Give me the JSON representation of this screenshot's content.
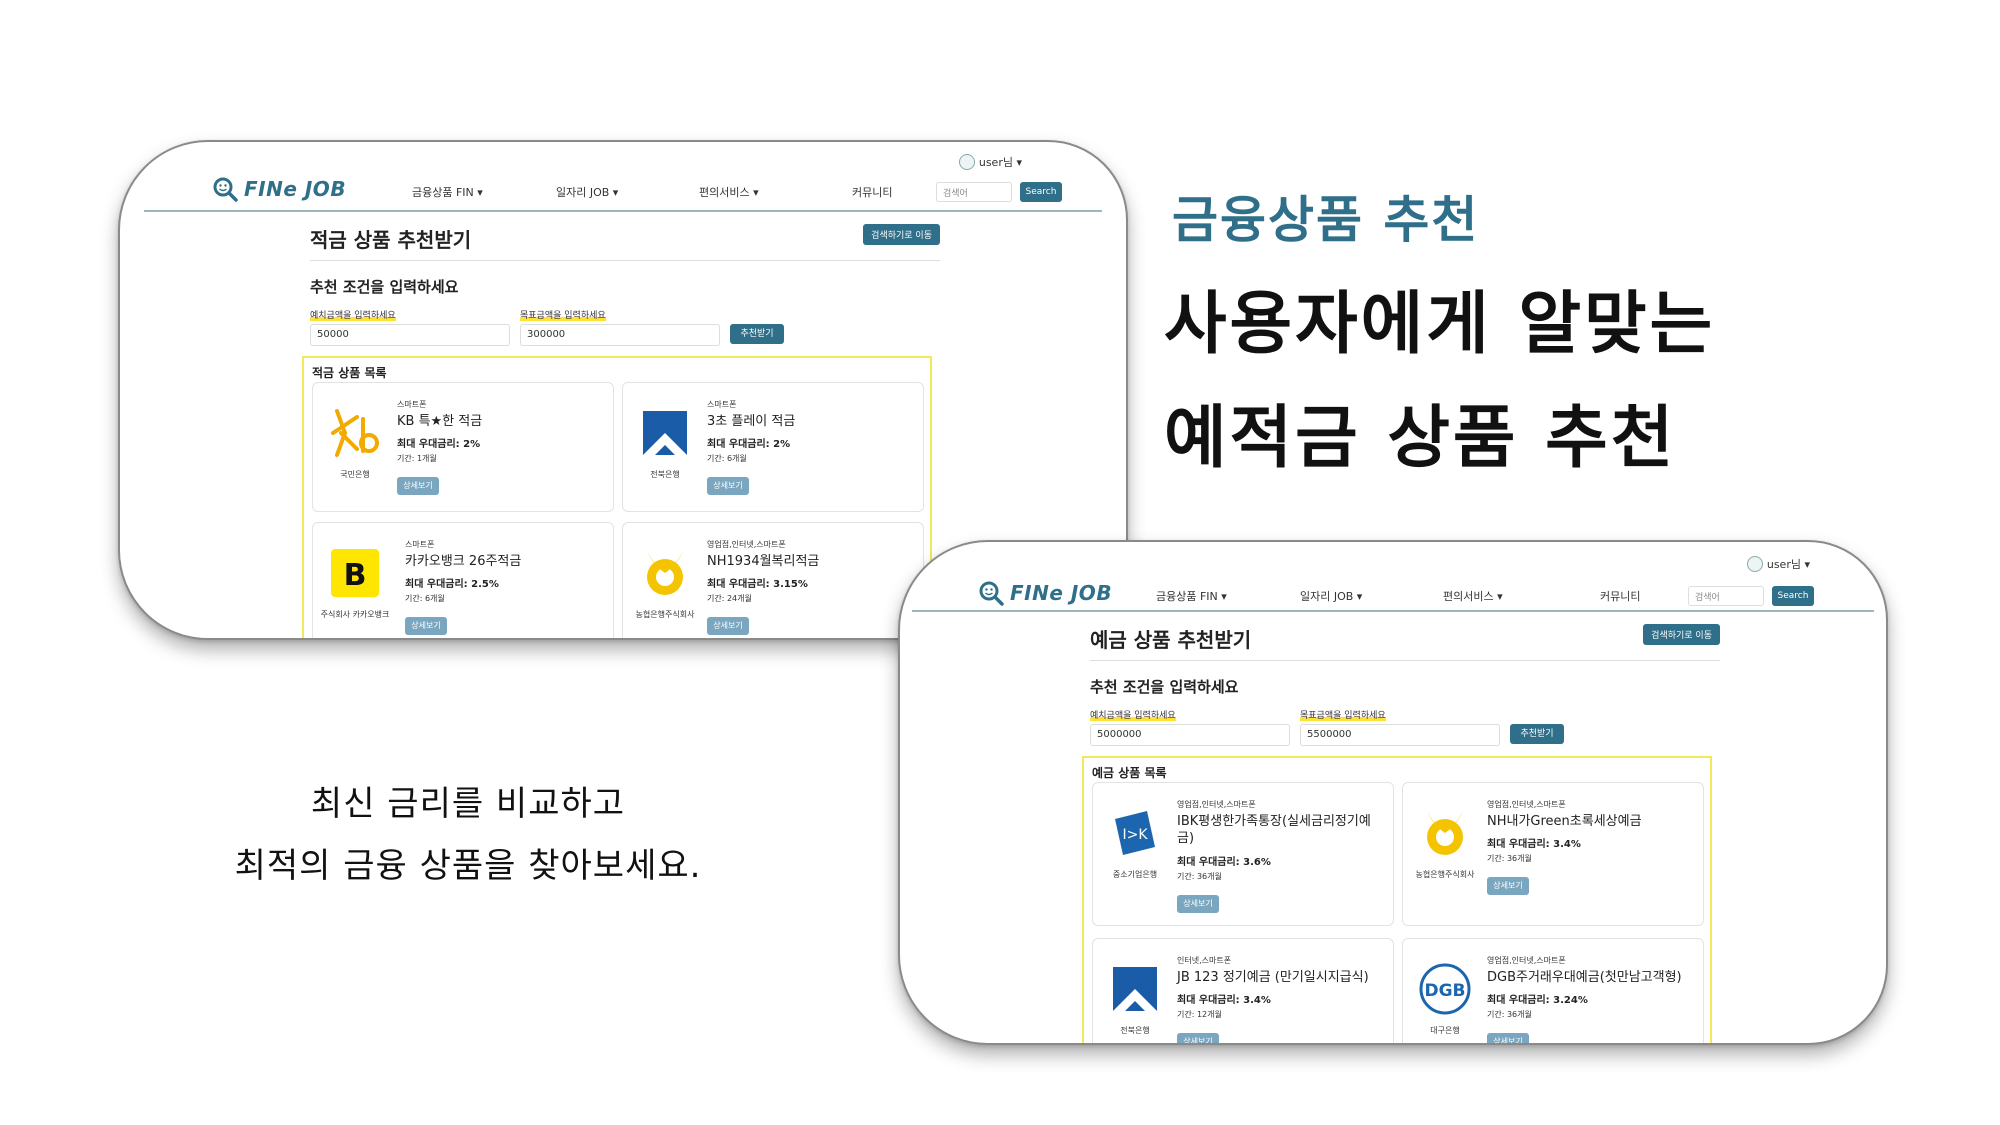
{
  "heading": {
    "label": "금융상품 추천",
    "line1": "사용자에게 알맞는",
    "line2": "예적금 상품 추천"
  },
  "caption": {
    "line1": "최신 금리를 비교하고",
    "line2": "최적의 금융 상품을 찾아보세요."
  },
  "colors": {
    "brand": "#2f6f89",
    "highlight": "#f3e85a",
    "detail": "#7aa6bf"
  },
  "app": {
    "logo": "FINe JOB",
    "nav": [
      "금융상품 FIN ▾",
      "일자리 JOB ▾",
      "편의서비스 ▾",
      "커뮤니티"
    ],
    "user": "user님 ▾",
    "search_placeholder": "검색어",
    "search_button": "Search"
  },
  "savings": {
    "title": "적금 상품 추천받기",
    "move_button": "검색하기로 이동",
    "subtitle": "추천 조건을 입력하세요",
    "label_deposit": "예치금액을 입력하세요",
    "label_target": "목표금액을 입력하세요",
    "value_deposit": "50000",
    "value_target": "300000",
    "recommend_button": "추천받기",
    "list_title": "적금 상품 목록",
    "detail_label": "상세보기",
    "items": [
      {
        "bank": "국민은행",
        "channel": "스마트폰",
        "name": "KB 특★한 적금",
        "rate": "최대 우대금리: 2%",
        "period": "기간: 1개월",
        "logo": "kb-logo"
      },
      {
        "bank": "전북은행",
        "channel": "스마트폰",
        "name": "3초 플레이 적금",
        "rate": "최대 우대금리: 2%",
        "period": "기간: 6개월",
        "logo": "jb-logo"
      },
      {
        "bank": "주식회사 카카오뱅크",
        "channel": "스마트폰",
        "name": "카카오뱅크 26주적금",
        "rate": "최대 우대금리: 2.5%",
        "period": "기간: 6개월",
        "logo": "kakao-logo"
      },
      {
        "bank": "농협은행주식회사",
        "channel": "영업점,인터넷,스마트폰",
        "name": "NH1934월복리적금",
        "rate": "최대 우대금리: 3.15%",
        "period": "기간: 24개월",
        "logo": "nh-logo"
      }
    ]
  },
  "deposits": {
    "title": "예금 상품 추천받기",
    "move_button": "검색하기로 이동",
    "subtitle": "추천 조건을 입력하세요",
    "label_deposit": "예치금액을 입력하세요",
    "label_target": "목표금액을 입력하세요",
    "value_deposit": "5000000",
    "value_target": "5500000",
    "recommend_button": "추천받기",
    "list_title": "예금 상품 목록",
    "detail_label": "상세보기",
    "items": [
      {
        "bank": "중소기업은행",
        "channel": "영업점,인터넷,스마트폰",
        "name": "IBK평생한가족통장(실세금리정기예금)",
        "rate": "최대 우대금리: 3.6%",
        "period": "기간: 36개월",
        "logo": "ibk-logo"
      },
      {
        "bank": "농협은행주식회사",
        "channel": "영업점,인터넷,스마트폰",
        "name": "NH내가Green초록세상예금",
        "rate": "최대 우대금리: 3.4%",
        "period": "기간: 36개월",
        "logo": "nh-logo"
      },
      {
        "bank": "전북은행",
        "channel": "인터넷,스마트폰",
        "name": "JB 123 정기예금 (만기일시지급식)",
        "rate": "최대 우대금리: 3.4%",
        "period": "기간: 12개월",
        "logo": "jb-logo"
      },
      {
        "bank": "대구은행",
        "channel": "영업점,인터넷,스마트폰",
        "name": "DGB주거래우대예금(첫만남고객형)",
        "rate": "최대 우대금리: 3.24%",
        "period": "기간: 36개월",
        "logo": "dgb-logo"
      }
    ]
  }
}
